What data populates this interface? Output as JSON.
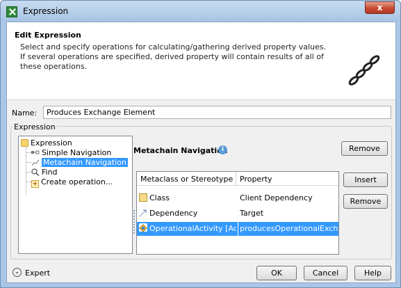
{
  "window": {
    "title": "Expression",
    "close_glyph": "x"
  },
  "header": {
    "title": "Edit Expression",
    "description": "Select and specify operations for calculating/gathering derived property values. If several operations are specified, derived property will contain results of all of these operations."
  },
  "name_field": {
    "label": "Name:",
    "value": "Produces Exchange Element"
  },
  "expression_group": {
    "label": "Expression"
  },
  "tree": {
    "items": [
      {
        "label": "Expression",
        "icon": "folder-icon"
      },
      {
        "label": "Simple Navigation",
        "icon": "navigation-icon"
      },
      {
        "label": "Metachain Navigation",
        "icon": "metachain-icon",
        "selected": true
      },
      {
        "label": "Find",
        "icon": "find-icon"
      },
      {
        "label": "Create operation...",
        "icon": "plus-icon"
      }
    ]
  },
  "panel": {
    "title": "Metachain Navigation",
    "info_glyph": "i",
    "remove_label": "Remove",
    "insert_label": "Insert",
    "remove_row_label": "Remove"
  },
  "table": {
    "columns": [
      "Metaclass or Stereotype",
      "Property"
    ],
    "rows": [
      {
        "metaclass": "Class",
        "property": "Client Dependency",
        "icon": "class-icon"
      },
      {
        "metaclass": "Dependency",
        "property": "Target",
        "icon": "dependency-icon"
      },
      {
        "metaclass": "OperationalActivity [Acti...",
        "property": "producesOperationalExchan...",
        "icon": "operational-activity-icon",
        "selected": true
      }
    ]
  },
  "footer": {
    "expert_label": "Expert",
    "expert_glyph": "⌄",
    "ok_label": "OK",
    "cancel_label": "Cancel",
    "help_label": "Help"
  },
  "colors": {
    "selection": "#3399ff",
    "title_bar": "#a9c6e6",
    "close_button": "#c74a33"
  }
}
